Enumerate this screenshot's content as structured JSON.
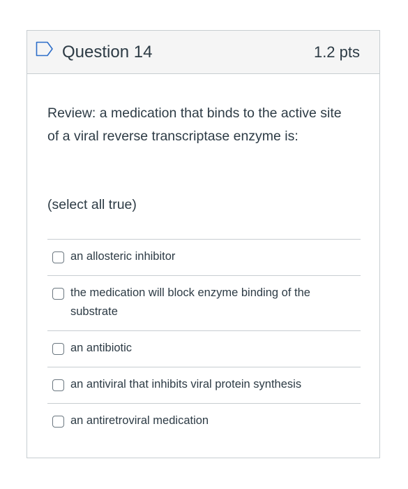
{
  "question": {
    "title": "Question 14",
    "points": "1.2 pts",
    "text": "Review: a medication that binds to the active site of a viral reverse transcriptase enzyme is:",
    "instruction": "(select all true)",
    "answers": [
      {
        "label": "an allosteric inhibitor",
        "checked": false
      },
      {
        "label": "the medication will block enzyme binding of the substrate",
        "checked": false
      },
      {
        "label": "an antibiotic",
        "checked": false
      },
      {
        "label": "an antiviral that inhibits viral protein synthesis",
        "checked": false
      },
      {
        "label": "an antiretroviral medication",
        "checked": false
      }
    ]
  },
  "colors": {
    "text": "#2d3b45",
    "border": "#c7cdd1",
    "header_bg": "#f5f5f5",
    "flag_icon": "#2d6ec9"
  },
  "icons": {
    "flag": "flag-question-icon"
  }
}
